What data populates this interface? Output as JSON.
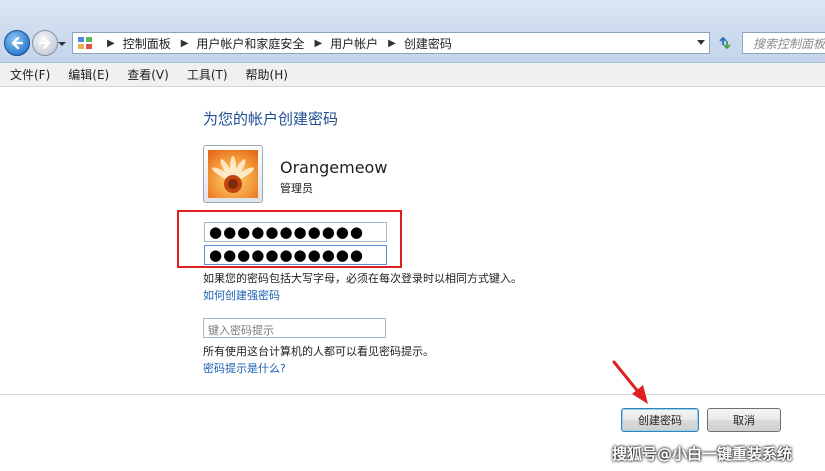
{
  "nav": {
    "breadcrumbs": [
      "控制面板",
      "用户帐户和家庭安全",
      "用户帐户",
      "创建密码"
    ],
    "search_placeholder": "搜索控制面板"
  },
  "menu": [
    "文件(F)",
    "编辑(E)",
    "查看(V)",
    "工具(T)",
    "帮助(H)"
  ],
  "page": {
    "heading": "为您的帐户创建密码",
    "user": {
      "name": "Orangemeow",
      "role": "管理员"
    },
    "new_password_value": "●●●●●●●●●●●",
    "confirm_password_value": "●●●●●●●●●●●",
    "case_note": "如果您的密码包括大写字母，必须在每次登录时以相同方式键入。",
    "strong_password_link": "如何创建强密码",
    "hint_placeholder": "键入密码提示",
    "hint_note": "所有使用这台计算机的人都可以看见密码提示。",
    "hint_link": "密码提示是什么?"
  },
  "buttons": {
    "create": "创建密码",
    "cancel": "取消"
  },
  "annotation": {
    "box_color": "#e02020"
  },
  "watermark": "搜狐号@小白一键重装系统",
  "colors": {
    "heading": "#1f4e95",
    "link": "#1a5fb4"
  }
}
